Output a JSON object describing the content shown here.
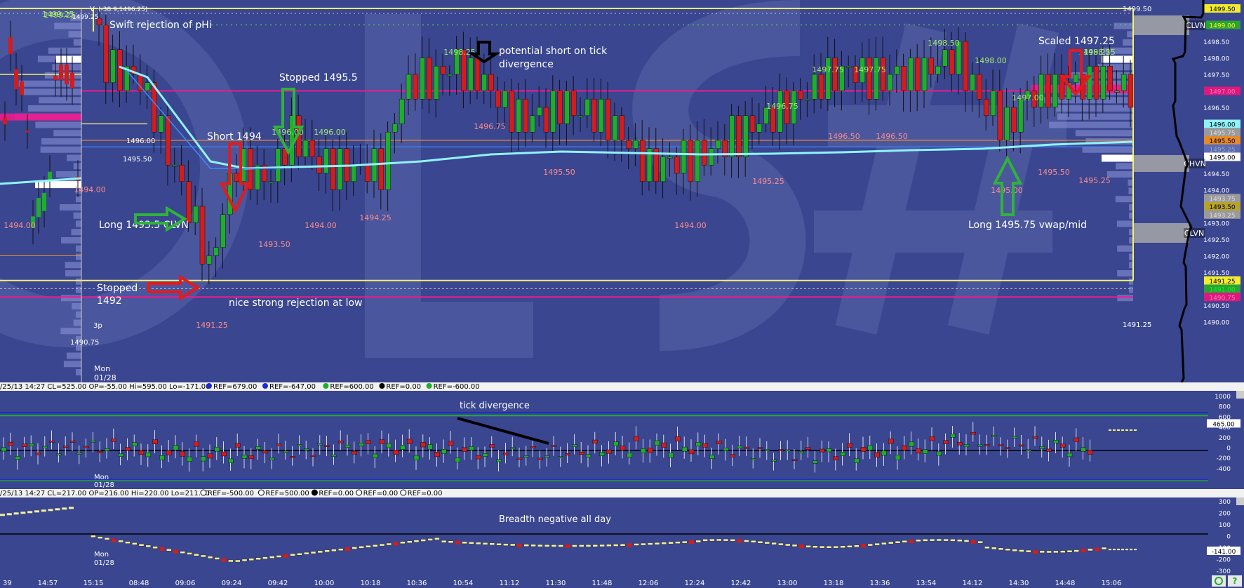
{
  "colors": {
    "bg": "#3a4690",
    "up": "#1fae2a",
    "down": "#d11d1d",
    "yellow": "#f5f070",
    "magenta": "#ee1a8c",
    "vwap": "#8ff3ff",
    "green_lbl": "#a4e86a",
    "red_lbl": "#ff8b8b",
    "ann_green": "#2fb33a",
    "ann_red": "#e51a1a"
  },
  "main": {
    "header_values": [
      "1499.25",
      "1499.25",
      "V",
      "(-38.9,1496.25)"
    ],
    "annotations": {
      "pHi": "Swift rejection of pHi",
      "long_clvn": "Long 1493.5 CLVN",
      "stopped1492_a": "Stopped",
      "stopped1492_b": "1492",
      "rejection": "nice strong rejection at low",
      "short1494": "Short 1494",
      "stopped1495": "Stopped 1495.5",
      "pot_short_a": "potential short on tick",
      "pot_short_b": "divergence",
      "scaled": "Scaled 1497.25",
      "long_vwap": "Long 1495.75 vwap/mid"
    },
    "session_label": [
      "3p",
      "Mon",
      "01/28"
    ],
    "right_axis": {
      "ticks": [
        "1499.50",
        "1499.00",
        "1498.50",
        "1498.00",
        "1497.50",
        "1497.00",
        "1496.50",
        "1496.00",
        "1495.50",
        "1495.00",
        "1494.50",
        "1494.00",
        "1493.50",
        "1493.00",
        "1492.50",
        "1492.00",
        "1491.50",
        "1491.00",
        "1490.50",
        "1490.00"
      ],
      "tags": [
        {
          "text": "1499.50",
          "bg": "#f2ec2c",
          "fg": "#000"
        },
        {
          "text": "1499.00",
          "bg": "#2aa23a",
          "fg": "#ff0"
        },
        {
          "text": "1497.00",
          "bg": "#e0177e",
          "fg": "#ff7ab8"
        },
        {
          "text": "1496.00",
          "bg": "#8ff3ff",
          "fg": "#000"
        },
        {
          "text": "1495.75",
          "bg": "#9a9a9a",
          "fg": "#ddd"
        },
        {
          "text": "1495.50",
          "bg": "#e58a2a",
          "fg": "#000"
        },
        {
          "text": "1495.25",
          "bg": "#5a6ab8",
          "fg": "#9aa"
        },
        {
          "text": "1495.00",
          "bg": "#ffffff",
          "fg": "#000"
        },
        {
          "text": "1493.75",
          "bg": "#9a9a9a",
          "fg": "#ddd"
        },
        {
          "text": "1493.50",
          "bg": "#b7a32a",
          "fg": "#000"
        },
        {
          "text": "1493.25",
          "bg": "#9a9a9a",
          "fg": "#ddd"
        },
        {
          "text": "1491.25",
          "bg": "#f2ec2c",
          "fg": "#000"
        },
        {
          "text": "1491.00",
          "bg": "#2aa23a",
          "fg": "#0f0"
        },
        {
          "text": "1490.75",
          "bg": "#e0177e",
          "fg": "#ff7ab8"
        }
      ],
      "zone_labels": [
        "CLVN",
        "CHVN",
        "CLVN"
      ]
    },
    "price_labels": {
      "green": [
        "1499.25",
        "1498.25",
        "1496.00",
        "1496.00",
        "1498.25",
        "1496.75",
        "1497.75",
        "1497.75",
        "1498.50",
        "1498.00",
        "1497.00",
        "1498.25"
      ],
      "red": [
        "1494.00",
        "1494.00",
        "1491.25",
        "1493.50",
        "1494.00",
        "1494.25",
        "1496.75",
        "1495.50",
        "1494.00",
        "1495.25",
        "1496.50",
        "1496.50",
        "1495.00",
        "1495.50",
        "1495.25"
      ],
      "white": [
        "1496.00",
        "1495.50",
        "1499.50",
        "1491.25",
        "1490.75"
      ]
    }
  },
  "tick_panel": {
    "header": "/25/13 14:27 CL=525.00 OP=-55.00 Hi=595.00 Lo=-171.00",
    "refs": [
      "REF=679.00",
      "REF=-647.00",
      "REF=600.00",
      "REF=0.00",
      "REF=-600.00"
    ],
    "annotation": "tick divergence",
    "axis": [
      "1000",
      "800",
      "600",
      "400",
      "200",
      "0",
      "-200",
      "-400"
    ],
    "current": "465.00",
    "session": [
      "Mon",
      "01/28"
    ]
  },
  "breadth_panel": {
    "header": "/25/13 14:27 CL=217.00 OP=216.00 Hi=220.00 Lo=211.00",
    "refs": [
      "REF=-500.00",
      "REF=500.00",
      "REF=0.00",
      "REF=0.00",
      "REF=0.00"
    ],
    "annotation": "Breadth negative all day",
    "axis": [
      "300",
      "200",
      "100",
      "0",
      "-100",
      "-200",
      "-300"
    ],
    "current": "-141.00",
    "session": [
      "Mon",
      "01/28"
    ]
  },
  "time_axis": [
    "39",
    "14:57",
    "15:15",
    "08:48",
    "09:06",
    "09:24",
    "09:42",
    "10:00",
    "10:18",
    "10:36",
    "10:54",
    "11:12",
    "11:30",
    "11:48",
    "12:06",
    "12:24",
    "12:42",
    "13:00",
    "13:18",
    "13:36",
    "13:54",
    "14:12",
    "14:30",
    "14:48",
    "15:06"
  ],
  "footer_icons": [
    "refresh-icon",
    "help-icon"
  ],
  "chart_data": [
    {
      "type": "candlestick",
      "title": "",
      "ylabel": "",
      "ylim": [
        1489.75,
        1499.75
      ],
      "x": [
        "14:57",
        "15:15",
        "08:48",
        "09:06",
        "09:24",
        "09:42",
        "10:00",
        "10:18",
        "10:36",
        "10:54",
        "11:12",
        "11:30",
        "11:48",
        "12:06",
        "12:24",
        "12:42",
        "13:00",
        "13:18",
        "13:36",
        "13:54",
        "14:12",
        "14:30",
        "14:48",
        "15:06"
      ],
      "series": [
        {
          "close": [
            1496.75,
            1497.5,
            1497.0,
            1496.5,
            1494.0,
            1492.0,
            1493.5,
            1494.75,
            1495.5,
            1495.0,
            1494.75,
            1497.0,
            1497.75,
            1497.25,
            1496.25,
            1496.25,
            1494.5,
            1494.75,
            1495.75,
            1496.5,
            1497.75,
            1497.0,
            1497.5,
            1497.75,
            1496.5,
            1496.0,
            1497.0,
            1497.25,
            1497.0
          ]
        }
      ],
      "levels": {
        "pHi": 1499.5,
        "pLo": 1491.25,
        "vwap": 1495.75
      }
    },
    {
      "type": "bar",
      "title": "",
      "ylim": [
        -600,
        1000
      ],
      "reference_lines": [
        600,
        0,
        -600
      ],
      "last": 465
    },
    {
      "type": "line",
      "title": "",
      "ylim": [
        -300,
        300
      ],
      "reference_lines": [
        0
      ],
      "last": -141
    }
  ]
}
